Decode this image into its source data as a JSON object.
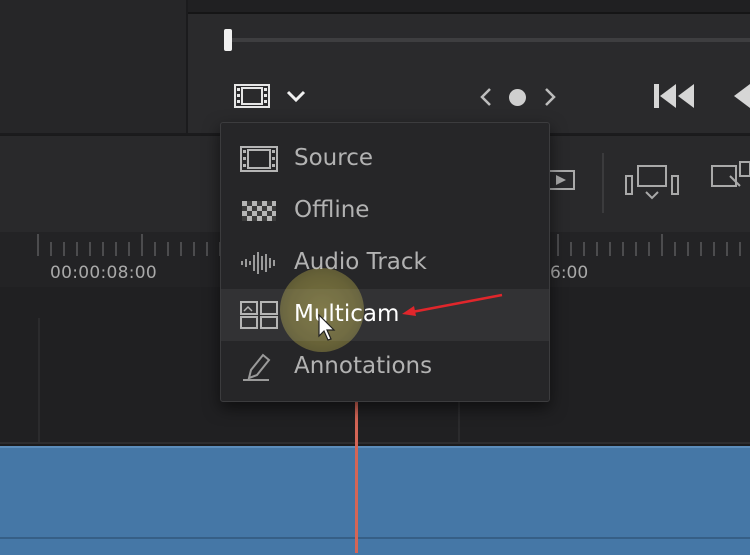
{
  "viewer": {
    "icons": {
      "clip_view": "film-strip-icon",
      "dropdown": "chevron-down-icon",
      "prev": "chevron-left-icon",
      "dot": "dot-icon",
      "next": "chevron-right-icon",
      "skip_back": "skip-to-start-icon",
      "play_reverse": "play-reverse-icon"
    }
  },
  "toolbar": {
    "icons": [
      "replace-clip-icon",
      "fit-to-fill-icon",
      "overwrite-icon"
    ]
  },
  "timeline": {
    "timecode_left": "00:00:08:00",
    "timecode_right": "6:00"
  },
  "menu": {
    "items": [
      {
        "label": "Source",
        "icon": "film-strip-icon"
      },
      {
        "label": "Offline",
        "icon": "checkerboard-icon"
      },
      {
        "label": "Audio Track",
        "icon": "waveform-icon"
      },
      {
        "label": "Multicam",
        "icon": "multicam-grid-icon",
        "highlighted": true
      },
      {
        "label": "Annotations",
        "icon": "pen-icon"
      }
    ]
  },
  "colors": {
    "clip_blue": "#4577a6",
    "playhead_red": "#d46556",
    "annotation_arrow": "#e0262b",
    "highlight_yellow": "#cbbd3c"
  }
}
